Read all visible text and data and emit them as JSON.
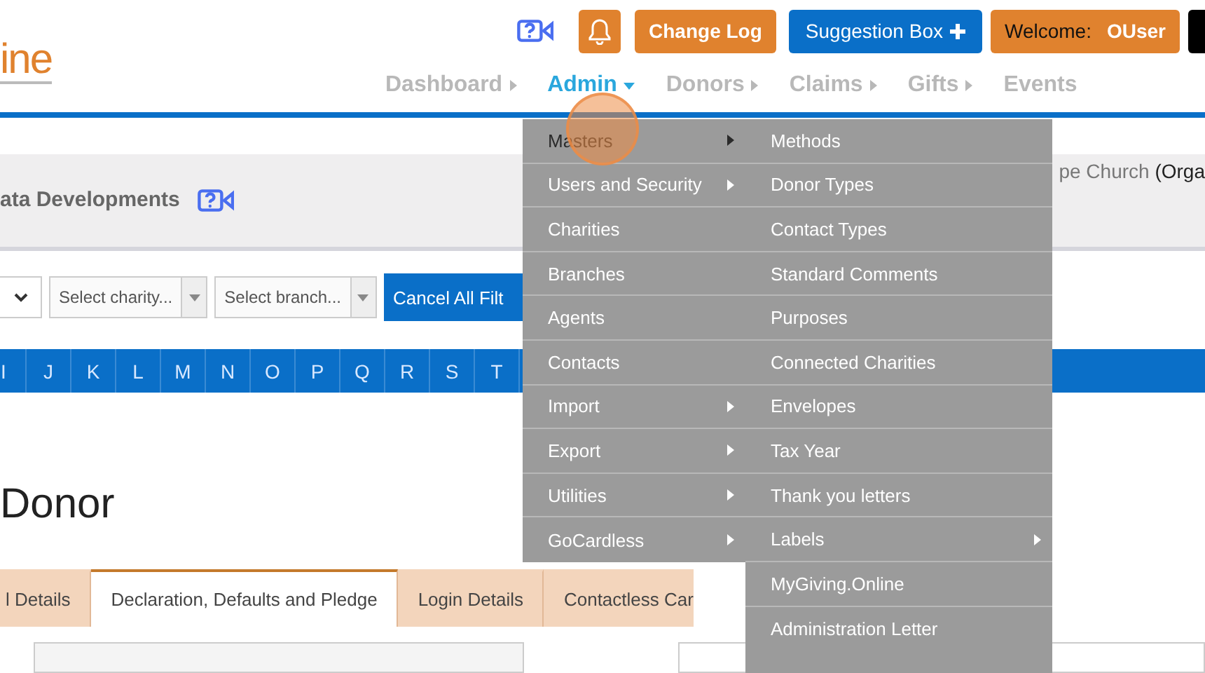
{
  "header": {
    "logo": "ine",
    "top_buttons": [
      {
        "kind": "bell"
      },
      {
        "kind": "text",
        "label": "Change Log"
      },
      {
        "kind": "suggest",
        "label": "Suggestion Box"
      },
      {
        "kind": "welcome",
        "label": "Welcome:",
        "user": "OUser"
      },
      {
        "kind": "dark"
      }
    ],
    "nav": [
      {
        "label": "Dashboard",
        "selected": false,
        "submenu": true
      },
      {
        "label": "Admin",
        "selected": true,
        "submenu": true
      },
      {
        "label": "Donors",
        "selected": false,
        "submenu": true
      },
      {
        "label": "Claims",
        "selected": false,
        "submenu": true
      },
      {
        "label": "Gifts",
        "selected": false,
        "submenu": true
      },
      {
        "label": "Events",
        "selected": false,
        "submenu": false
      }
    ]
  },
  "banner": {
    "title": "ata Developments",
    "org_name": "pe Church",
    "org_type": "(Orga"
  },
  "filters": {
    "charity_placeholder": "Select charity...",
    "branch_placeholder": "Select branch...",
    "cancel_button": "Cancel All Filt"
  },
  "alphabet": [
    "I",
    "J",
    "K",
    "L",
    "M",
    "N",
    "O",
    "P",
    "Q",
    "R",
    "S",
    "T"
  ],
  "heading": "Donor",
  "tabs": [
    {
      "label": "l Details",
      "selected": false
    },
    {
      "label": "Declaration, Defaults and Pledge",
      "selected": true
    },
    {
      "label": "Login Details",
      "selected": false
    },
    {
      "label": "Contactless Car",
      "selected": false
    }
  ],
  "admin_menu": [
    {
      "label": "Masters",
      "submenu": true,
      "selected": true
    },
    {
      "label": "Users and Security",
      "submenu": true,
      "selected": false
    },
    {
      "label": "Charities",
      "submenu": false,
      "selected": false
    },
    {
      "label": "Branches",
      "submenu": false,
      "selected": false
    },
    {
      "label": "Agents",
      "submenu": false,
      "selected": false
    },
    {
      "label": "Contacts",
      "submenu": false,
      "selected": false
    },
    {
      "label": "Import",
      "submenu": true,
      "selected": false
    },
    {
      "label": "Export",
      "submenu": true,
      "selected": false
    },
    {
      "label": "Utilities",
      "submenu": true,
      "selected": false
    },
    {
      "label": "GoCardless",
      "submenu": true,
      "selected": false
    }
  ],
  "masters_menu": [
    {
      "label": "Methods",
      "submenu": false
    },
    {
      "label": "Donor Types",
      "submenu": false
    },
    {
      "label": "Contact Types",
      "submenu": false
    },
    {
      "label": "Standard Comments",
      "submenu": false
    },
    {
      "label": "Purposes",
      "submenu": false
    },
    {
      "label": "Connected Charities",
      "submenu": false
    },
    {
      "label": "Envelopes",
      "submenu": false
    },
    {
      "label": "Tax Year",
      "submenu": false
    },
    {
      "label": "Thank you letters",
      "submenu": false
    },
    {
      "label": "Labels",
      "submenu": true
    },
    {
      "label": "MyGiving.Online",
      "submenu": false
    },
    {
      "label": "Administration Letter",
      "submenu": false
    }
  ]
}
